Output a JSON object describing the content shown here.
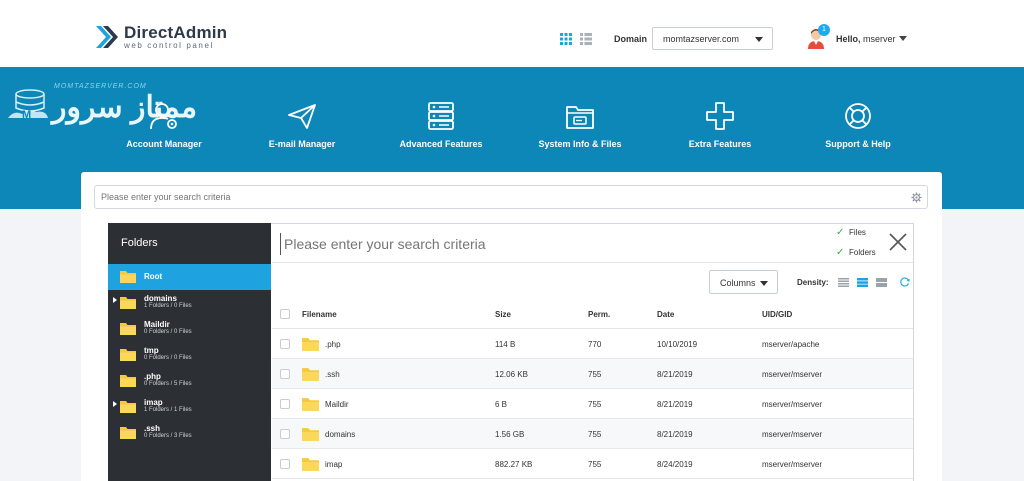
{
  "header": {
    "logo_title": "DirectAdmin",
    "logo_subtitle": "web control panel",
    "grid_view_icon": "grid-icon",
    "list_view_icon": "list-icon",
    "domain_label": "Domain",
    "domain_value": "momtazserver.com",
    "notification_count": "1",
    "hello_label": "Hello,",
    "username": "mserver",
    "accent_color": "#1ea3e0"
  },
  "watermark": {
    "url": "MOMTAZSERVER.COM",
    "text": "ممتاز سرور"
  },
  "menu": [
    {
      "label": "Account Manager",
      "icon": "account-manager-icon"
    },
    {
      "label": "E-mail Manager",
      "icon": "paper-plane-icon"
    },
    {
      "label": "Advanced Features",
      "icon": "server-icon"
    },
    {
      "label": "System Info & Files",
      "icon": "folder-drive-icon"
    },
    {
      "label": "Extra Features",
      "icon": "plus-icon"
    },
    {
      "label": "Support & Help",
      "icon": "lifebuoy-icon"
    }
  ],
  "search": {
    "placeholder": "Please enter your search criteria"
  },
  "file_manager": {
    "sidebar_title": "Folders",
    "folders": [
      {
        "name": "Root",
        "sub": "",
        "has_children": false,
        "active": true
      },
      {
        "name": "domains",
        "sub": "1 Folders / 0 Files",
        "has_children": true
      },
      {
        "name": "Maildir",
        "sub": "0 Folders / 0 Files",
        "has_children": false
      },
      {
        "name": "tmp",
        "sub": "0 Folders / 0 Files",
        "has_children": false
      },
      {
        "name": ".php",
        "sub": "0 Folders / 5 Files",
        "has_children": false
      },
      {
        "name": "imap",
        "sub": "1 Folders / 1 Files",
        "has_children": true
      },
      {
        "name": ".ssh",
        "sub": "0 Folders / 3 Files",
        "has_children": false
      }
    ],
    "search_placeholder": "Please enter your search criteria",
    "filter_files": "Files",
    "filter_folders": "Folders",
    "columns_label": "Columns",
    "density_label": "Density:",
    "table_headers": {
      "filename": "Filename",
      "size": "Size",
      "perm": "Perm.",
      "date": "Date",
      "uid": "UID/GID"
    },
    "rows": [
      {
        "name": ".php",
        "size": "114 B",
        "perm": "770",
        "date": "10/10/2019",
        "uid": "mserver/apache"
      },
      {
        "name": ".ssh",
        "size": "12.06 KB",
        "perm": "755",
        "date": "8/21/2019",
        "uid": "mserver/mserver"
      },
      {
        "name": "Maildir",
        "size": "6 B",
        "perm": "755",
        "date": "8/21/2019",
        "uid": "mserver/mserver"
      },
      {
        "name": "domains",
        "size": "1.56 GB",
        "perm": "755",
        "date": "8/21/2019",
        "uid": "mserver/mserver"
      },
      {
        "name": "imap",
        "size": "882.27 KB",
        "perm": "755",
        "date": "8/24/2019",
        "uid": "mserver/mserver"
      }
    ]
  }
}
